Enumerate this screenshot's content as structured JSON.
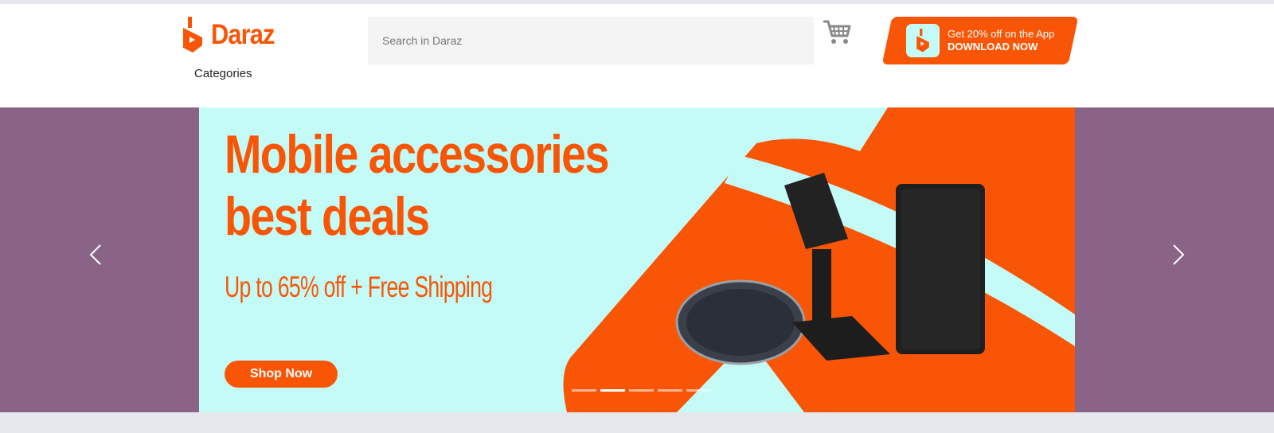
{
  "brand": {
    "name": "Daraz",
    "color": "#f85606",
    "logo_icon": "daraz-logo-icon"
  },
  "nav": {
    "categories_label": "Categories"
  },
  "search": {
    "placeholder": "Search in Daraz",
    "value": ""
  },
  "cart": {
    "icon": "cart-icon"
  },
  "app_promo": {
    "line1": "Get 20% off on the App",
    "line2": "DOWNLOAD NOW",
    "icon": "daraz-app-icon"
  },
  "carousel": {
    "background_color": "#8a6487",
    "slide": {
      "background_color": "#c4fbf7",
      "headline_line1": "Mobile accessories",
      "headline_line2": "best deals",
      "subline": "Up to 65% off +  Free Shipping",
      "cta_label": "Shop Now"
    },
    "dots_count": 5,
    "active_dot": 1,
    "prev_icon": "chevron-left-icon",
    "next_icon": "chevron-right-icon"
  }
}
